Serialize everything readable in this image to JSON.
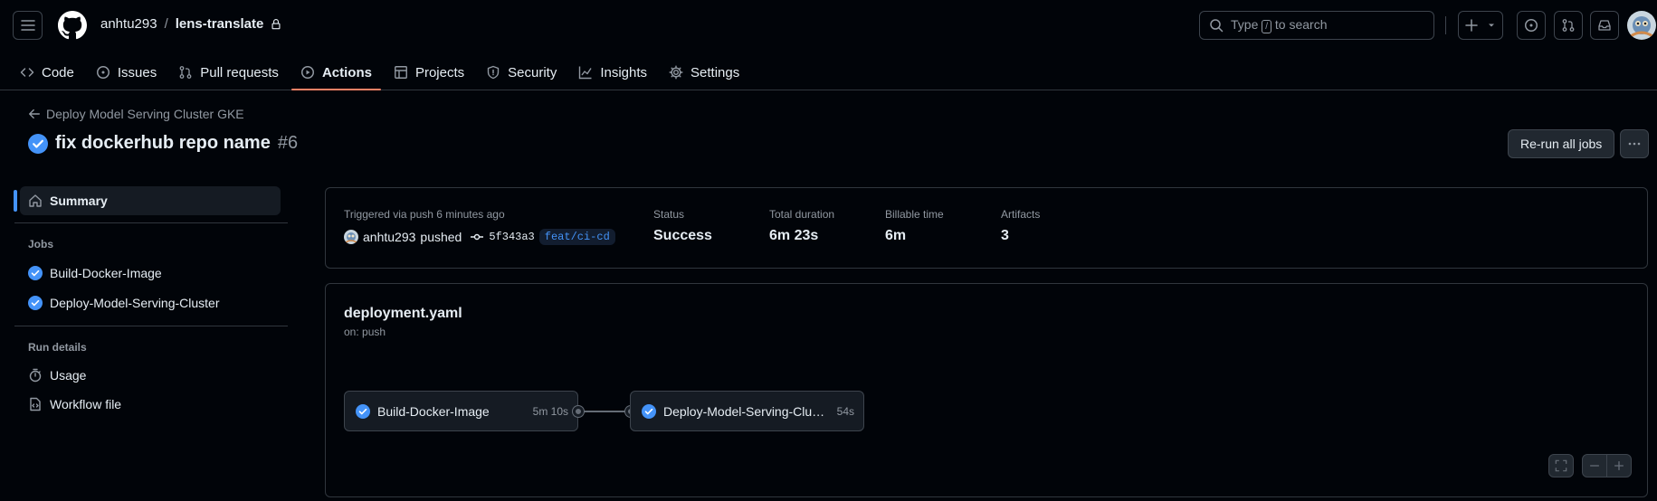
{
  "header": {
    "owner": "anhtu293",
    "separator": "/",
    "repo": "lens-translate",
    "search": {
      "prefix": "Type",
      "key": "/",
      "suffix": "to search"
    }
  },
  "tabs": [
    {
      "label": "Code",
      "icon": "code-icon"
    },
    {
      "label": "Issues",
      "icon": "issue-icon"
    },
    {
      "label": "Pull requests",
      "icon": "pull-request-icon"
    },
    {
      "label": "Actions",
      "icon": "play-icon",
      "active": true
    },
    {
      "label": "Projects",
      "icon": "table-icon"
    },
    {
      "label": "Security",
      "icon": "shield-icon"
    },
    {
      "label": "Insights",
      "icon": "graph-icon"
    },
    {
      "label": "Settings",
      "icon": "gear-icon"
    }
  ],
  "run": {
    "back_label": "Deploy Model Serving Cluster GKE",
    "title": "fix dockerhub repo name",
    "number": "#6",
    "rerun_label": "Re-run all jobs"
  },
  "sidebar": {
    "summary_label": "Summary",
    "jobs_heading": "Jobs",
    "jobs": [
      "Build-Docker-Image",
      "Deploy-Model-Serving-Cluster"
    ],
    "details_heading": "Run details",
    "usage_label": "Usage",
    "workflow_file_label": "Workflow file"
  },
  "summary": {
    "triggered_label": "Triggered via push 6 minutes ago",
    "actor": "anhtu293",
    "action": "pushed",
    "sha": "5f343a3",
    "branch": "feat/ci-cd",
    "status_label": "Status",
    "status_value": "Success",
    "duration_label": "Total duration",
    "duration_value": "6m 23s",
    "billable_label": "Billable time",
    "billable_value": "6m",
    "artifacts_label": "Artifacts",
    "artifacts_value": "3"
  },
  "workflow": {
    "file": "deployment.yaml",
    "trigger": "on: push",
    "jobs": [
      {
        "name": "Build-Docker-Image",
        "duration": "5m 10s"
      },
      {
        "name": "Deploy-Model-Serving-Cluster",
        "duration": "54s"
      }
    ]
  },
  "colors": {
    "accent_blue": "#4493f8",
    "active_tab_underline": "#f78166",
    "success_check": "#4493f8"
  }
}
